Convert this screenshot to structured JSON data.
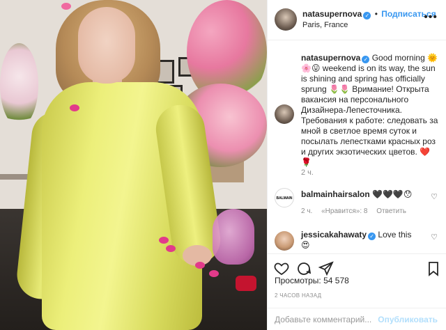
{
  "post": {
    "username": "natasupernova",
    "follow_label": "Подписаться",
    "location": "Paris, France",
    "more_label": "•••"
  },
  "caption": {
    "username": "natasupernova",
    "text": "Good morning 🌞 🌸😛 weekend is on its way, the sun is shining and spring has officially sprung 🌷🌷 Вримание! Открыта вакансия на персонального Дизайнера-Лепесточника. Требования к работе: следовать за мной в светлое время суток и посылать лепестками красных роз и других экзотических цветов. ❤️🌹",
    "time": "2 ч."
  },
  "comments": [
    {
      "username": "balmainhairsalon",
      "text": "🖤🖤🖤😯",
      "time": "2 ч.",
      "likes_label": "«Нравится»: 8",
      "reply_label": "Ответить",
      "avatar_text": "BALMAIN"
    },
    {
      "username": "jessicakahawaty",
      "text": "Love this 😍"
    }
  ],
  "actions": {
    "like_icon": "heart-icon",
    "comment_icon": "comment-icon",
    "share_icon": "share-icon",
    "save_icon": "bookmark-icon"
  },
  "stats": {
    "views_label": "Просмотры: 54 578",
    "posted_label": "2 ЧАСОВ НАЗАД"
  },
  "add_comment": {
    "placeholder": "Добавьте комментарий...",
    "publish_label": "Опубликовать"
  },
  "colors": {
    "accent": "#3897f0",
    "muted": "#8e8e8e",
    "publish_disabled": "#b2dffc",
    "dress": "#eef07f"
  }
}
